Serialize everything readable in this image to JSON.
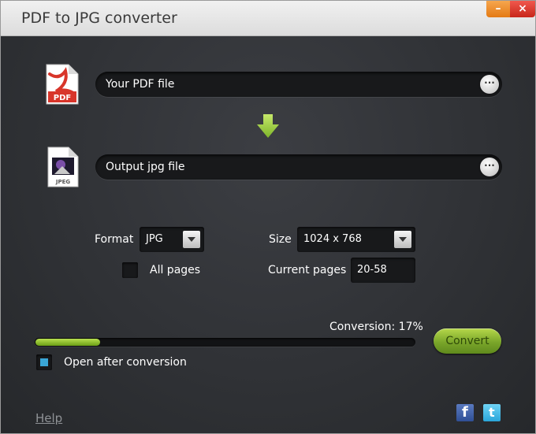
{
  "window": {
    "title": "PDF to JPG converter",
    "minimize_glyph": "–",
    "close_glyph": "×"
  },
  "input": {
    "pdf_label": "Your PDF file",
    "jpg_label": "Output jpg file",
    "browse_glyph": "···",
    "pdf_icon_text": "PDF",
    "jpg_icon_text": "JPEG"
  },
  "options": {
    "format_label": "Format",
    "format_value": "JPG",
    "size_label": "Size",
    "size_value": "1024 x 768",
    "all_pages_label": "All pages",
    "current_pages_label": "Current pages",
    "current_pages_value": "20-58"
  },
  "progress": {
    "status_text": "Conversion: 17%",
    "percent": 17
  },
  "actions": {
    "convert_label": "Convert",
    "open_after_label": "Open after conversion",
    "open_after_checked": true,
    "help_label": "Help"
  },
  "social": {
    "facebook_glyph": "f",
    "twitter_glyph": "t",
    "icons": [
      "facebook-icon",
      "twitter-icon"
    ]
  },
  "colors": {
    "accent_green": "#7aa62a",
    "progress_green": "#9bcb3a",
    "checkbox_blue": "#3aa6d6",
    "pdf_red": "#d8352a"
  }
}
